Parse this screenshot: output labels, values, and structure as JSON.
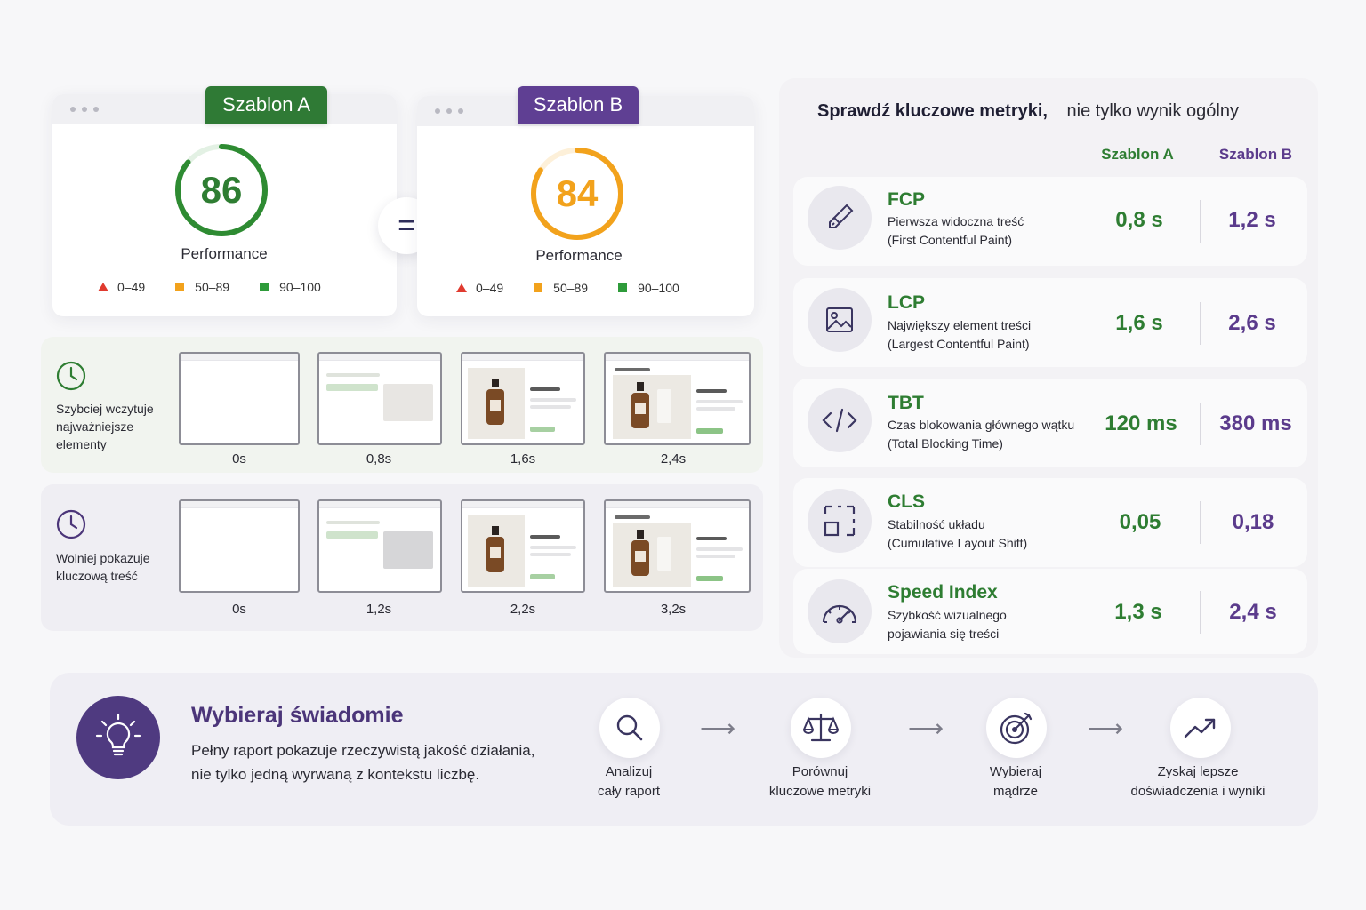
{
  "colors": {
    "green": "#2e7d32",
    "purple": "#5b3b8c",
    "orange": "#f2a21c",
    "red": "#e03a2f"
  },
  "cardA": {
    "tab": "Szablon A",
    "score": "86",
    "score_value": 86,
    "label": "Performance",
    "legend": [
      "0–49",
      "50–89",
      "90–100"
    ]
  },
  "cardB": {
    "tab": "Szablon B",
    "score": "84",
    "score_value": 84,
    "label": "Performance",
    "legend": [
      "0–49",
      "50–89",
      "90–100"
    ]
  },
  "equals": "=",
  "filmA": {
    "text": "Szybciej wczytuje najważniejsze elementy",
    "times": [
      "0s",
      "0,8s",
      "1,6s",
      "2,4s"
    ]
  },
  "filmB": {
    "text": "Wolniej pokazuje kluczową treść",
    "times": [
      "0s",
      "1,2s",
      "2,2s",
      "3,2s"
    ]
  },
  "metrics": {
    "title_bold": "Sprawdź kluczowe metryki,",
    "title_rest": "nie tylko wynik ogólny",
    "col_a": "Szablon A",
    "col_b": "Szablon B",
    "rows": [
      {
        "icon": "paintbrush-icon",
        "name": "FCP",
        "desc1": "Pierwsza widoczna treść",
        "desc2": "(First Contentful Paint)",
        "a": "0,8 s",
        "b": "1,2 s"
      },
      {
        "icon": "image-icon",
        "name": "LCP",
        "desc1": "Największy element treści",
        "desc2": "(Largest Contentful Paint)",
        "a": "1,6 s",
        "b": "2,6 s"
      },
      {
        "icon": "code-icon",
        "name": "TBT",
        "desc1": "Czas blokowania głównego wątku",
        "desc2": "(Total Blocking Time)",
        "a": "120 ms",
        "b": "380 ms"
      },
      {
        "icon": "layout-shift-icon",
        "name": "CLS",
        "desc1": "Stabilność układu",
        "desc2": "(Cumulative Layout Shift)",
        "a": "0,05",
        "b": "0,18"
      },
      {
        "icon": "speedometer-icon",
        "name": "Speed Index",
        "desc1": "Szybkość wizualnego",
        "desc2": "pojawiania się treści",
        "a": "1,3 s",
        "b": "2,4 s"
      }
    ]
  },
  "banner": {
    "title": "Wybieraj świadomie",
    "line1": "Pełny raport pokazuje rzeczywistą jakość działania,",
    "line2": "nie tylko jedną wyrwaną z kontekstu liczbę.",
    "steps": [
      {
        "icon": "search-icon",
        "l1": "Analizuj",
        "l2": "cały raport"
      },
      {
        "icon": "scales-icon",
        "l1": "Porównuj",
        "l2": "kluczowe metryki"
      },
      {
        "icon": "target-icon",
        "l1": "Wybieraj",
        "l2": "mądrze"
      },
      {
        "icon": "trend-up-icon",
        "l1": "Zyskaj lepsze",
        "l2": "doświadczenia i wyniki"
      }
    ]
  }
}
